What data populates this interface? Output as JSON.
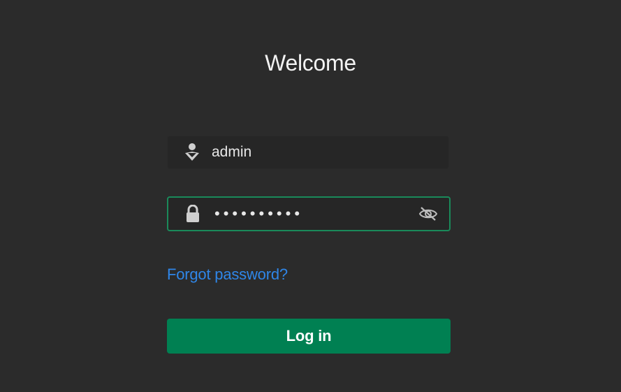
{
  "page": {
    "title": "Welcome"
  },
  "username": {
    "icon": "user-icon",
    "value": "admin"
  },
  "password": {
    "icon": "lock-icon",
    "masked_value": "••••••••••",
    "toggle_icon": "eye-off-icon"
  },
  "links": {
    "forgot_password": "Forgot password?"
  },
  "actions": {
    "login_label": "Log in"
  },
  "colors": {
    "background": "#2b2b2b",
    "accent": "#008052",
    "focus_border": "#1a8a5a",
    "link": "#2f86e8"
  }
}
